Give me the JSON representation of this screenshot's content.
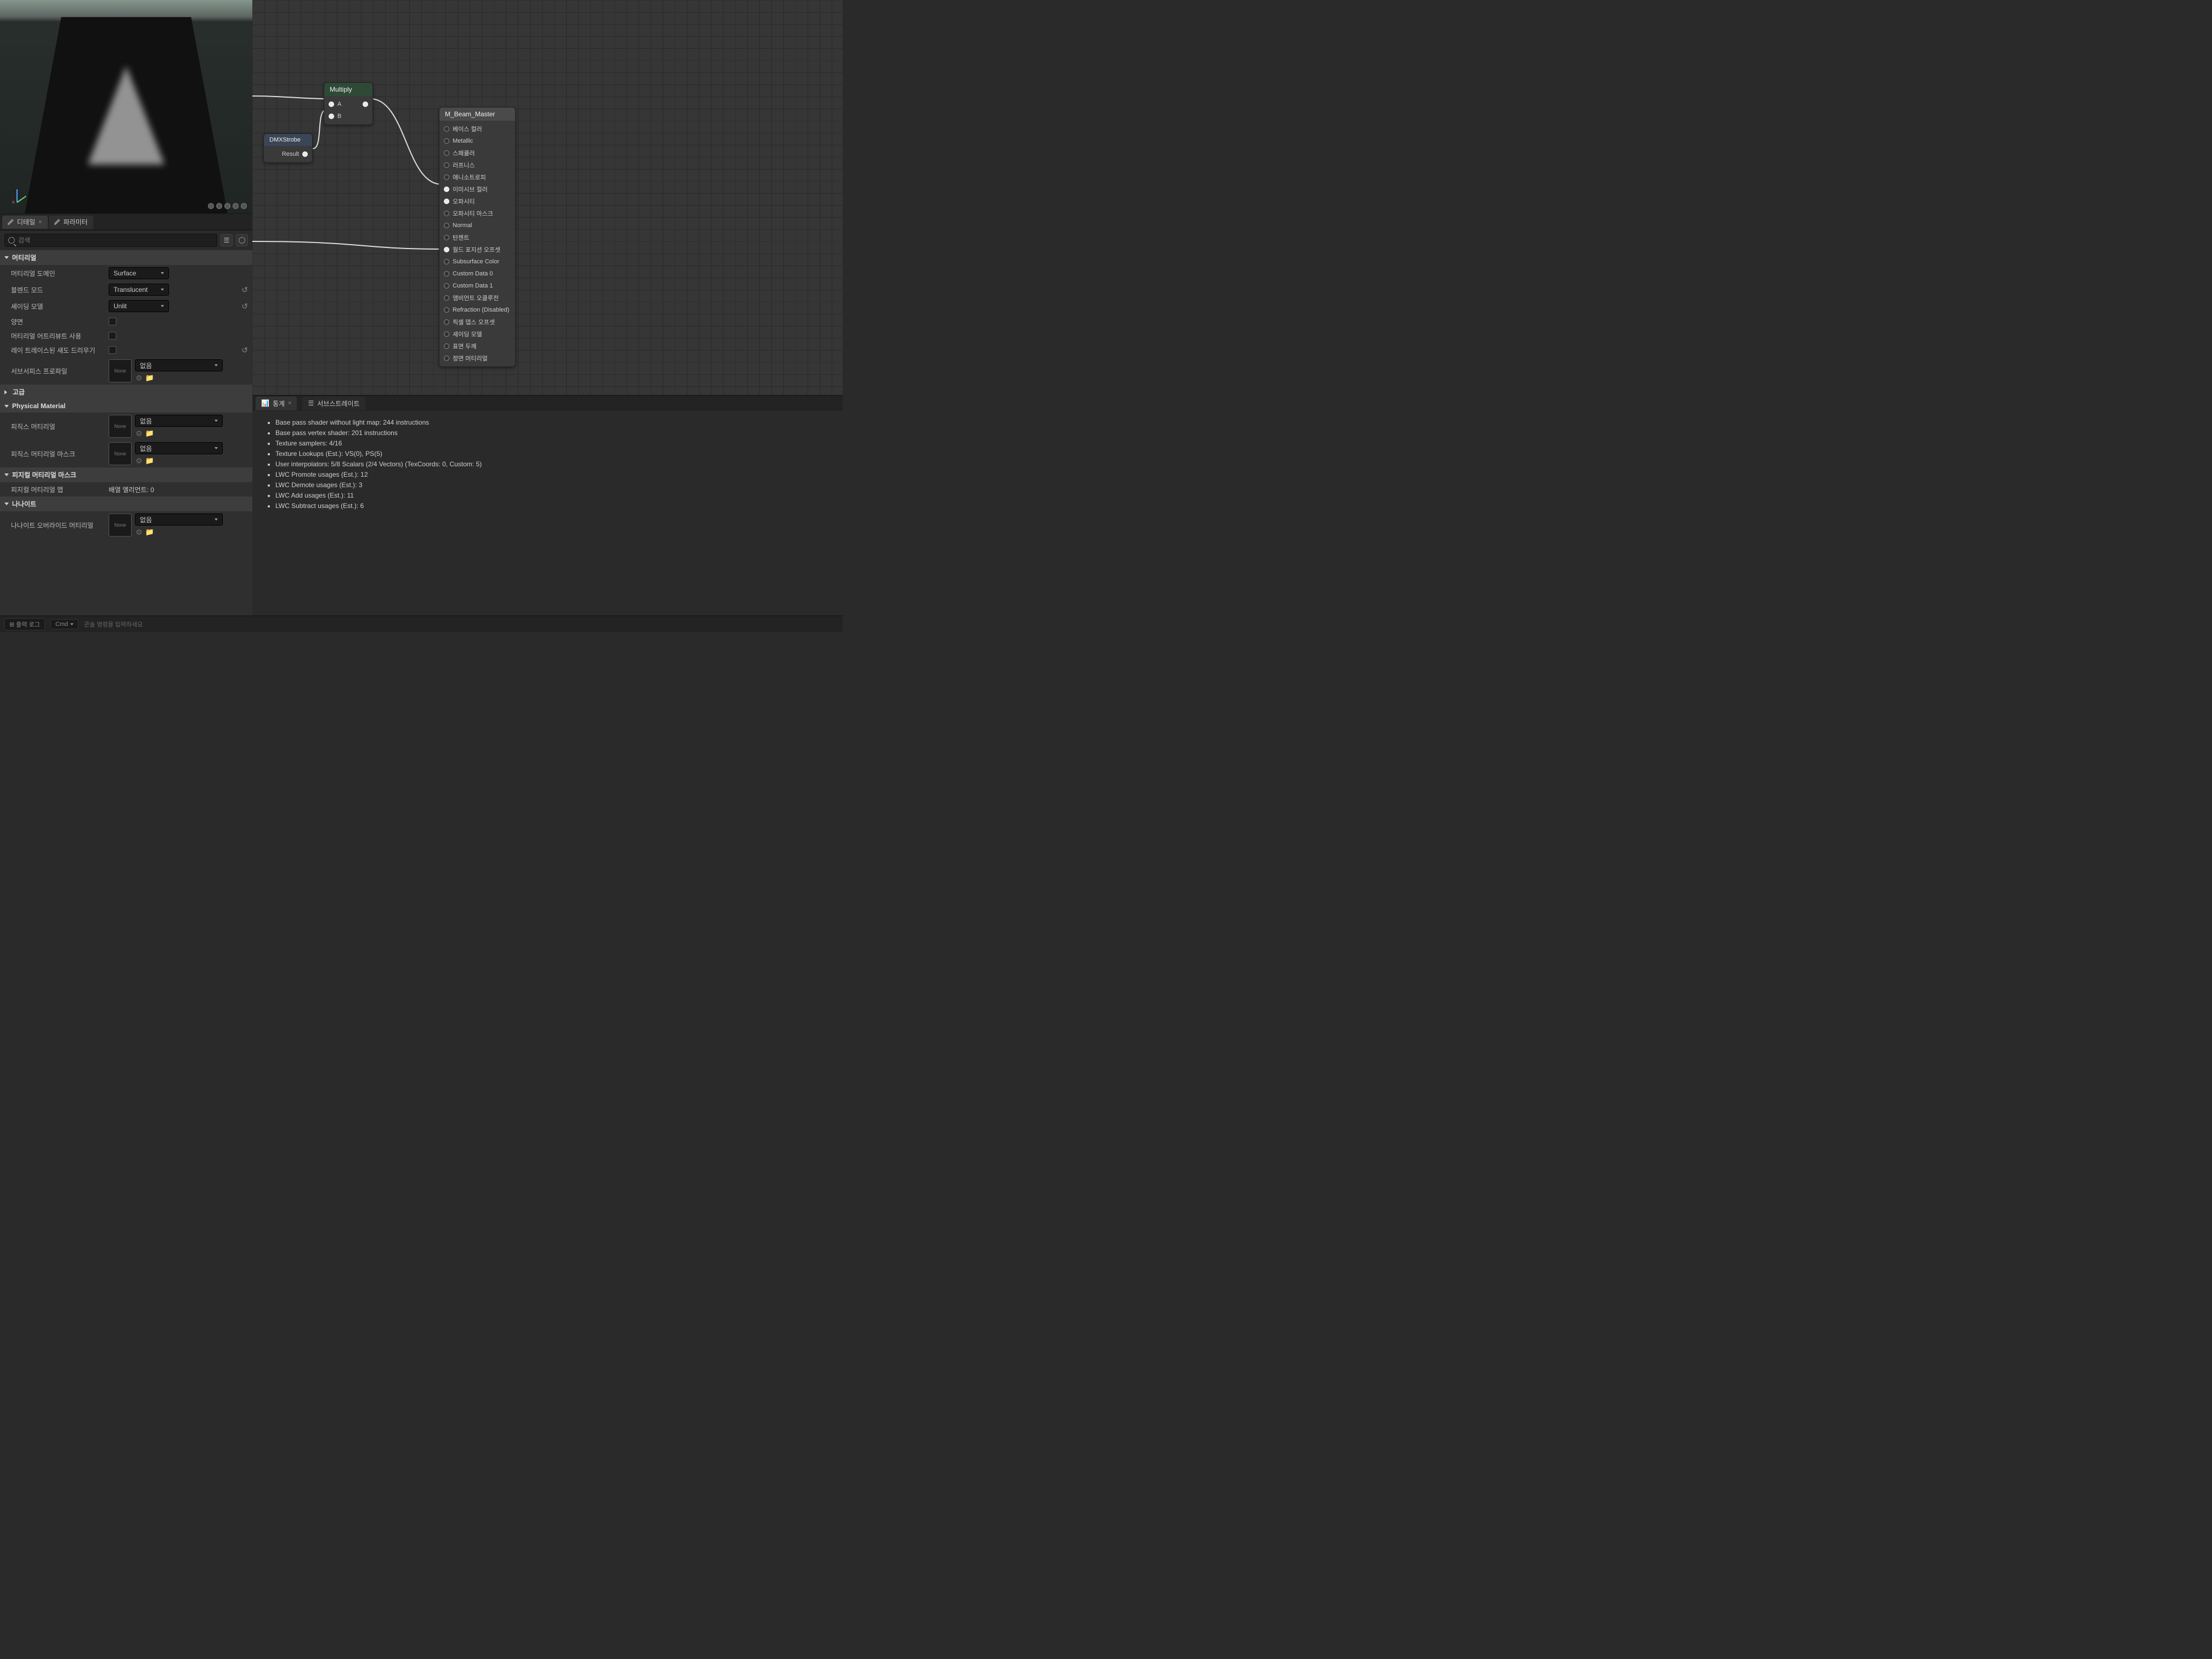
{
  "tabs": {
    "details": "디테일",
    "parameters": "파라미터"
  },
  "search": {
    "placeholder": "검색"
  },
  "categories": {
    "material": "머티리얼",
    "advanced": "고급",
    "physical": "Physical Material",
    "physmask": "피지컬 머티리얼 마스크",
    "nanite": "나나이트"
  },
  "props": {
    "materialDomain": {
      "label": "머티리얼 도메인",
      "value": "Surface"
    },
    "blendMode": {
      "label": "블렌드 모드",
      "value": "Translucent"
    },
    "shadingModel": {
      "label": "셰이딩 모델",
      "value": "Unlit"
    },
    "twoSided": {
      "label": "양면"
    },
    "useMatAttr": {
      "label": "머티리얼 어트리뷰트 사용"
    },
    "rayShadow": {
      "label": "레이 트레이스된 섀도 드리우기"
    },
    "subsurfaceProfile": {
      "label": "서브서피스 프로파일",
      "none": "없음"
    },
    "physicsMat": {
      "label": "피직스 머티리얼",
      "none": "없음"
    },
    "physicsMatMask": {
      "label": "피직스 머티리얼 마스크",
      "none": "없음"
    },
    "physMatMap": {
      "label": "피지컬 머티리얼 맵",
      "value": "배열 엘리먼트: 0"
    },
    "naniteOverride": {
      "label": "나나이트 오버라이드 머티리얼",
      "none": "없음"
    },
    "thumbNone": "None"
  },
  "graph": {
    "multiply": {
      "title": "Multiply",
      "pinA": "A",
      "pinB": "B"
    },
    "strobe": {
      "title": "DMXStrobe",
      "result": "Result"
    },
    "master": {
      "title": "M_Beam_Master",
      "pins": [
        "베이스 컬러",
        "Metallic",
        "스페큘러",
        "러프니스",
        "애니소트로피",
        "이미시브 컬러",
        "오파시티",
        "오파시티 마스크",
        "Normal",
        "탄젠트",
        "월드 포지션 오프셋",
        "Subsurface Color",
        "Custom Data 0",
        "Custom Data 1",
        "앰비언트 오클루전",
        "Refraction (Disabled)",
        "픽셀 뎁스 오프셋",
        "셰이딩 모델",
        "표면 두께",
        "정면 머티리얼"
      ],
      "connected_idx": [
        5,
        6,
        10
      ]
    }
  },
  "stats": {
    "tab1": "통계",
    "tab2": "서브스트레이트",
    "lines": [
      "Base pass shader without light map: 244 instructions",
      "Base pass vertex shader: 201 instructions",
      "Texture samplers: 4/16",
      "Texture Lookups (Est.): VS(0), PS(5)",
      "User interpolators: 5/8 Scalars (2/4 Vectors) (TexCoords: 0, Custom: 5)",
      "LWC Promote usages (Est.): 12",
      "LWC Demote usages (Est.): 3",
      "LWC Add usages (Est.): 11",
      "LWC Subtract usages (Est.): 6"
    ]
  },
  "cmdbar": {
    "cmd": "Cmd",
    "hint": "콘솔 명령을 입력하세요"
  }
}
